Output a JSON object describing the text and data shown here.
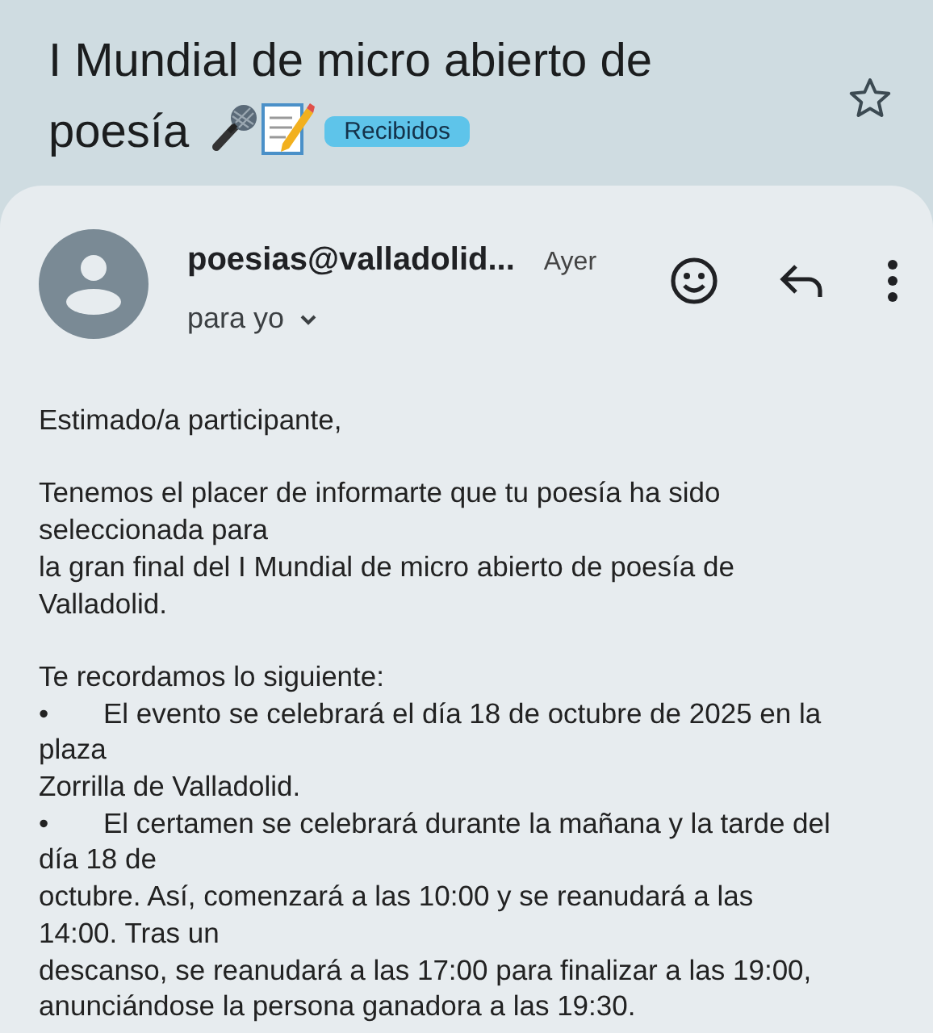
{
  "subject": {
    "title_lines": [
      "I Mundial de micro abierto de",
      "poesía"
    ],
    "label": "Recibidos",
    "starred": false
  },
  "message": {
    "sender": "poesias@valladolid...",
    "time": "Ayer",
    "recipient": "para yo"
  },
  "body": [
    {
      "kind": "paragraph",
      "lines": [
        "Estimado/a participante,"
      ]
    },
    {
      "kind": "paragraph",
      "lines": [
        "Tenemos el placer de informarte que tu poesía ha sido",
        "seleccionada para",
        "la gran final del I Mundial de micro abierto de poesía de",
        "Valladolid."
      ]
    },
    {
      "kind": "paragraph",
      "lines": [
        "Te recordamos lo siguiente:"
      ]
    },
    {
      "kind": "bullet",
      "bullet": "•",
      "lines": [
        "El evento se celebrará el día 18 de octubre de 2025 en la",
        "plaza",
        "Zorrilla de Valladolid."
      ]
    },
    {
      "kind": "bullet",
      "bullet": "•",
      "lines": [
        "El certamen se celebrará durante la mañana y la tarde del",
        "día 18 de",
        "octubre. Así, comenzará a las 10:00 y se reanudará a las",
        "14:00. Tras un",
        "descanso, se reanudará a las 17:00 para finalizar a las 19:00,",
        "anunciándose la persona ganadora a las 19:30."
      ]
    }
  ]
}
